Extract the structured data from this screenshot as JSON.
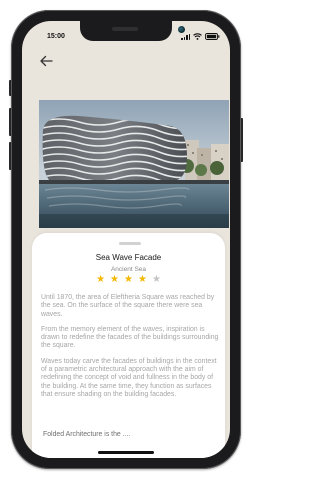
{
  "status_bar": {
    "time": "15:00"
  },
  "nav": {
    "back_icon": "arrow-left-icon"
  },
  "project": {
    "title": "Sea Wave Facade",
    "subtitle": "Ancient Sea",
    "rating": 4,
    "rating_max": 5,
    "paragraphs": [
      "Until 1870, the area of Eleftheria Square was reached by the sea. On the surface of the square there were sea waves.",
      "From the memory element of the waves, inspiration is drawn to redefine the facades of the buildings surrounding the square.",
      "Waves today carve the facades of buildings in the context of a parametric architectural approach with the aim of redefining the concept of void and fullness in the body of the building. At the same time, they function as surfaces that ensure shading on the building facades."
    ],
    "more_text": "Folded Architecture is the ...."
  },
  "colors": {
    "star_filled": "#f5b800",
    "star_empty": "#c4c4c4",
    "screen_bg": "#e9e4dc",
    "sheet_bg": "#ffffff"
  }
}
